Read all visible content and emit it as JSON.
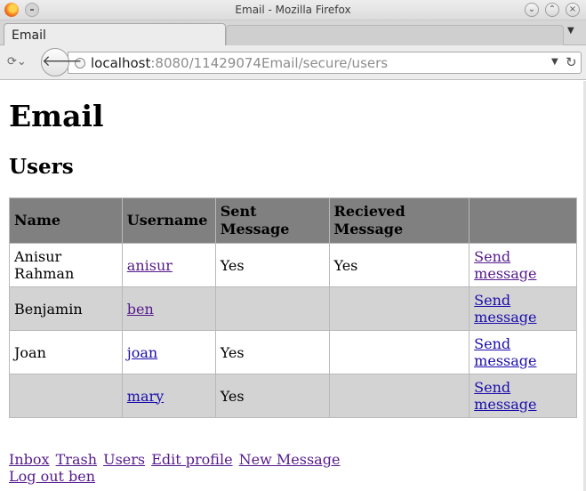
{
  "window": {
    "title": "Email - Mozilla Firefox"
  },
  "tabs": [
    {
      "label": "Email"
    }
  ],
  "navbar": {
    "url_host": "localhost",
    "url_rest": ":8080/11429074Email/secure/users"
  },
  "page": {
    "heading": "Email",
    "subheading": "Users",
    "table": {
      "columns": [
        "Name",
        "Username",
        "Sent Message",
        "Recieved Message",
        ""
      ],
      "rows": [
        {
          "name": "Anisur Rahman",
          "username": "anisur",
          "sent": "Yes",
          "received": "Yes",
          "action": "Send message"
        },
        {
          "name": "Benjamin",
          "username": "ben",
          "sent": "",
          "received": "",
          "action": "Send message"
        },
        {
          "name": "Joan",
          "username": "joan",
          "sent": "Yes",
          "received": "",
          "action": "Send message"
        },
        {
          "name": "",
          "username": "mary",
          "sent": "Yes",
          "received": "",
          "action": "Send message"
        }
      ]
    },
    "footer_links": [
      "Inbox",
      "Trash",
      "Users",
      "Edit profile",
      "New Message"
    ],
    "logout": "Log out ben"
  },
  "icons": [
    "firefox-icon",
    "window-menu-icon",
    "minimize-icon",
    "maximize-icon",
    "close-icon",
    "history-icon",
    "back-arrow-icon",
    "globe-icon",
    "dropdown-arrow-icon",
    "reload-icon"
  ]
}
